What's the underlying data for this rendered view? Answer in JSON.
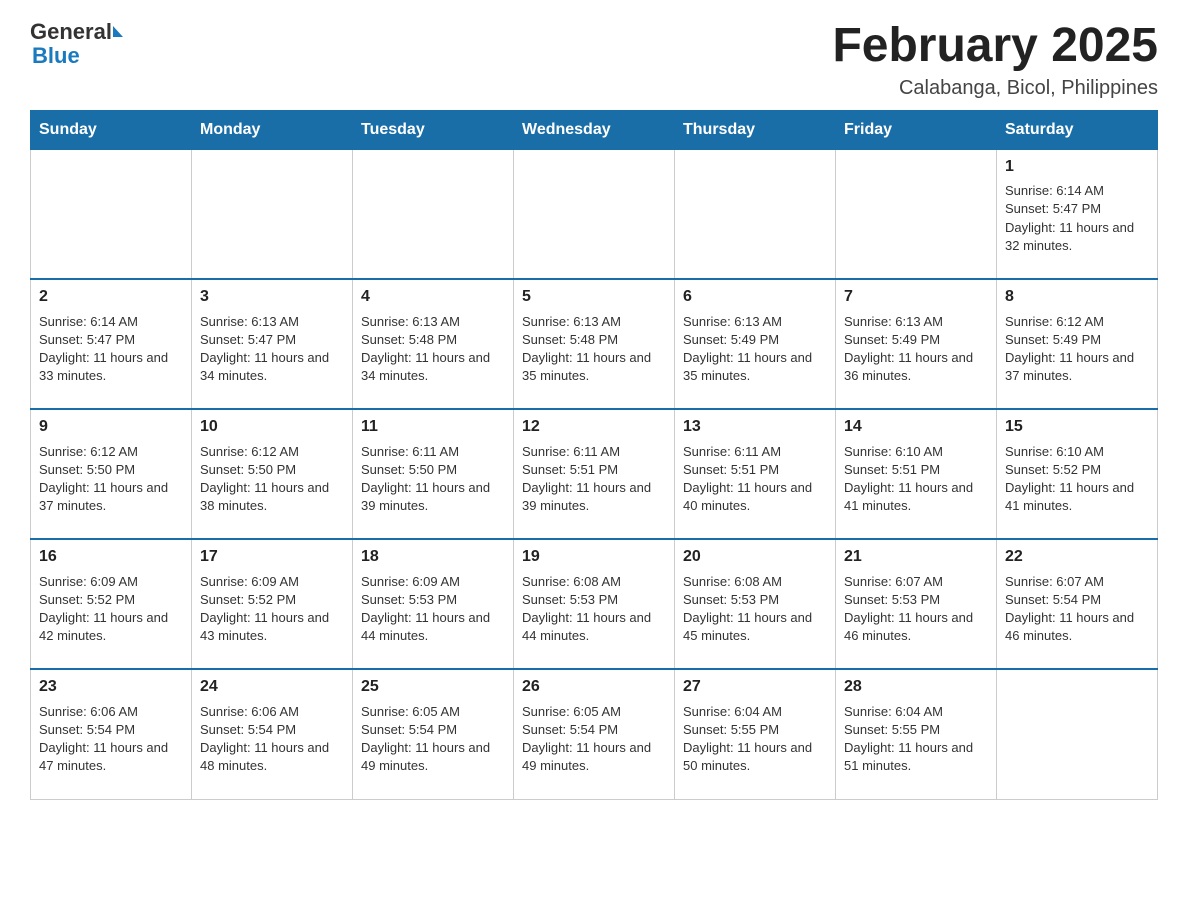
{
  "header": {
    "logo_general": "General",
    "logo_blue": "Blue",
    "title": "February 2025",
    "subtitle": "Calabanga, Bicol, Philippines"
  },
  "weekdays": [
    "Sunday",
    "Monday",
    "Tuesday",
    "Wednesday",
    "Thursday",
    "Friday",
    "Saturday"
  ],
  "weeks": [
    [
      null,
      null,
      null,
      null,
      null,
      null,
      {
        "day": "1",
        "sunrise": "6:14 AM",
        "sunset": "5:47 PM",
        "daylight": "11 hours and 32 minutes."
      }
    ],
    [
      {
        "day": "2",
        "sunrise": "6:14 AM",
        "sunset": "5:47 PM",
        "daylight": "11 hours and 33 minutes."
      },
      {
        "day": "3",
        "sunrise": "6:13 AM",
        "sunset": "5:47 PM",
        "daylight": "11 hours and 34 minutes."
      },
      {
        "day": "4",
        "sunrise": "6:13 AM",
        "sunset": "5:48 PM",
        "daylight": "11 hours and 34 minutes."
      },
      {
        "day": "5",
        "sunrise": "6:13 AM",
        "sunset": "5:48 PM",
        "daylight": "11 hours and 35 minutes."
      },
      {
        "day": "6",
        "sunrise": "6:13 AM",
        "sunset": "5:49 PM",
        "daylight": "11 hours and 35 minutes."
      },
      {
        "day": "7",
        "sunrise": "6:13 AM",
        "sunset": "5:49 PM",
        "daylight": "11 hours and 36 minutes."
      },
      {
        "day": "8",
        "sunrise": "6:12 AM",
        "sunset": "5:49 PM",
        "daylight": "11 hours and 37 minutes."
      }
    ],
    [
      {
        "day": "9",
        "sunrise": "6:12 AM",
        "sunset": "5:50 PM",
        "daylight": "11 hours and 37 minutes."
      },
      {
        "day": "10",
        "sunrise": "6:12 AM",
        "sunset": "5:50 PM",
        "daylight": "11 hours and 38 minutes."
      },
      {
        "day": "11",
        "sunrise": "6:11 AM",
        "sunset": "5:50 PM",
        "daylight": "11 hours and 39 minutes."
      },
      {
        "day": "12",
        "sunrise": "6:11 AM",
        "sunset": "5:51 PM",
        "daylight": "11 hours and 39 minutes."
      },
      {
        "day": "13",
        "sunrise": "6:11 AM",
        "sunset": "5:51 PM",
        "daylight": "11 hours and 40 minutes."
      },
      {
        "day": "14",
        "sunrise": "6:10 AM",
        "sunset": "5:51 PM",
        "daylight": "11 hours and 41 minutes."
      },
      {
        "day": "15",
        "sunrise": "6:10 AM",
        "sunset": "5:52 PM",
        "daylight": "11 hours and 41 minutes."
      }
    ],
    [
      {
        "day": "16",
        "sunrise": "6:09 AM",
        "sunset": "5:52 PM",
        "daylight": "11 hours and 42 minutes."
      },
      {
        "day": "17",
        "sunrise": "6:09 AM",
        "sunset": "5:52 PM",
        "daylight": "11 hours and 43 minutes."
      },
      {
        "day": "18",
        "sunrise": "6:09 AM",
        "sunset": "5:53 PM",
        "daylight": "11 hours and 44 minutes."
      },
      {
        "day": "19",
        "sunrise": "6:08 AM",
        "sunset": "5:53 PM",
        "daylight": "11 hours and 44 minutes."
      },
      {
        "day": "20",
        "sunrise": "6:08 AM",
        "sunset": "5:53 PM",
        "daylight": "11 hours and 45 minutes."
      },
      {
        "day": "21",
        "sunrise": "6:07 AM",
        "sunset": "5:53 PM",
        "daylight": "11 hours and 46 minutes."
      },
      {
        "day": "22",
        "sunrise": "6:07 AM",
        "sunset": "5:54 PM",
        "daylight": "11 hours and 46 minutes."
      }
    ],
    [
      {
        "day": "23",
        "sunrise": "6:06 AM",
        "sunset": "5:54 PM",
        "daylight": "11 hours and 47 minutes."
      },
      {
        "day": "24",
        "sunrise": "6:06 AM",
        "sunset": "5:54 PM",
        "daylight": "11 hours and 48 minutes."
      },
      {
        "day": "25",
        "sunrise": "6:05 AM",
        "sunset": "5:54 PM",
        "daylight": "11 hours and 49 minutes."
      },
      {
        "day": "26",
        "sunrise": "6:05 AM",
        "sunset": "5:54 PM",
        "daylight": "11 hours and 49 minutes."
      },
      {
        "day": "27",
        "sunrise": "6:04 AM",
        "sunset": "5:55 PM",
        "daylight": "11 hours and 50 minutes."
      },
      {
        "day": "28",
        "sunrise": "6:04 AM",
        "sunset": "5:55 PM",
        "daylight": "11 hours and 51 minutes."
      },
      null
    ]
  ]
}
